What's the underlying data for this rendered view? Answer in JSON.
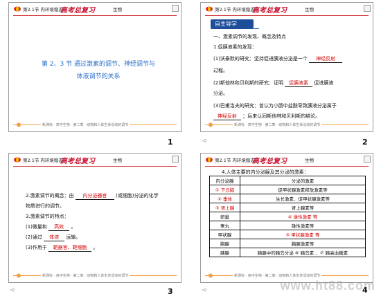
{
  "header": {
    "left": "第2.1节 内环境稳态",
    "brand": "高考总复习",
    "right": "生物"
  },
  "footer": {
    "text": "新课标 · 高中生物 · 第二章 · 动物和人体生命活动的调节"
  },
  "slides": [
    {
      "number": "1",
      "title_line1": "第 2、3 节  通过激素的调节、神经调节与",
      "title_line2": "体液调节的关系"
    },
    {
      "number": "2",
      "badge": "自主导学",
      "lines": [
        "一、激素调节的发现、概念及特点",
        "1.促胰液素的发现：",
        "(1)沃泰默的研究：坚持促进胰液分泌是一个",
        "过程。",
        "(2)斯他林和贝利斯的研究：证明",
        "促进胰液",
        "分泌。",
        "(3)巴甫洛夫的研究：曾认为小肠中盐酸导致胰液分泌属于",
        "；后来认同斯他林和贝利斯的结论。"
      ],
      "answers": [
        "神经反射",
        "促胰液素",
        "神经反射"
      ]
    },
    {
      "number": "3",
      "lines": [
        "2.激素调节的概念：由",
        "(或细胞)分泌的化学",
        "物质进行的调节。",
        "3.激素调节的特点：",
        "(1)微量和",
        "。",
        "(2)通过",
        "运输。",
        "(3)作用于",
        "。"
      ],
      "answers": [
        "内分泌器官",
        "高效",
        "体液",
        "靶器官、靶细胞"
      ]
    },
    {
      "number": "4",
      "heading": "4.人体主要的内分泌腺及其分泌的激素：",
      "table_header": [
        "内分泌腺",
        "分泌的激素"
      ],
      "rows": [
        [
          "① 下丘脑",
          "促甲状腺激素释放激素等"
        ],
        [
          "② 垂体",
          "生长激素、促甲状腺激素等"
        ],
        [
          "③ 肾上腺",
          "肾上腺素等"
        ],
        [
          "卵巢",
          "④ 雌性激素 等"
        ],
        [
          "睾丸",
          "雄性激素等"
        ],
        [
          "甲状腺",
          "⑤ 甲状腺激素 等"
        ],
        [
          "胸腺",
          "胸腺激素等"
        ],
        [
          "胰腺",
          "胰腺中的胰岛分泌 ⑥ 胰岛素 、⑦ 胰高血糖素"
        ]
      ]
    }
  ],
  "watermark": "www.ht88.com"
}
